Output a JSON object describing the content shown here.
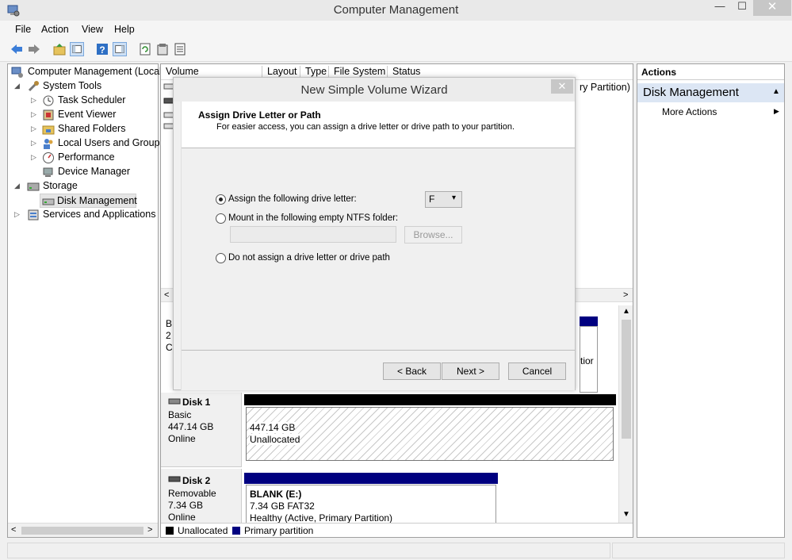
{
  "window": {
    "title": "Computer Management",
    "min_label": "—",
    "max_label": "☐",
    "close_label": "✕"
  },
  "menu": [
    "File",
    "Action",
    "View",
    "Help"
  ],
  "tree": {
    "root": "Computer Management (Local",
    "system_tools": "System Tools",
    "task_scheduler": "Task Scheduler",
    "event_viewer": "Event Viewer",
    "shared_folders": "Shared Folders",
    "local_users": "Local Users and Groups",
    "performance": "Performance",
    "device_manager": "Device Manager",
    "storage": "Storage",
    "disk_management": "Disk Management",
    "services": "Services and Applications"
  },
  "volume_list": {
    "columns": [
      "Volume",
      "Layout",
      "Type",
      "File System",
      "Status"
    ],
    "status_fragment": "ry Partition)",
    "scroll_left": "<",
    "scroll_right": ">"
  },
  "disk_view": {
    "partial_left_lines": [
      "B",
      "2",
      "C"
    ],
    "partial_right_text": "tior",
    "disk1": {
      "name": "Disk 1",
      "type": "Basic",
      "size": "447.14 GB",
      "state": "Online",
      "partition_size": "447.14 GB",
      "partition_label": "Unallocated"
    },
    "disk2": {
      "name": "Disk 2",
      "type": "Removable",
      "size": "7.34 GB",
      "state": "Online",
      "partition_name": "BLANK  (E:)",
      "partition_size": "7.34 GB FAT32",
      "partition_status": "Healthy (Active, Primary Partition)"
    },
    "legend": [
      {
        "label": "Unallocated",
        "color": "#000000"
      },
      {
        "label": "Primary partition",
        "color": "#000080"
      }
    ]
  },
  "actions": {
    "header": "Actions",
    "section": "Disk Management",
    "more": "More Actions"
  },
  "wizard": {
    "title": "New Simple Volume Wizard",
    "close_label": "✕",
    "heading": "Assign Drive Letter or Path",
    "subheading": "For easier access, you can assign a drive letter or drive path to your partition.",
    "option_letter": "Assign the following drive letter:",
    "option_folder": "Mount in the following empty NTFS folder:",
    "option_none": "Do not assign a drive letter or drive path",
    "drive_letter": "F",
    "folder_path": "",
    "browse": "Browse...",
    "back": "< Back",
    "next": "Next >",
    "cancel": "Cancel"
  },
  "colors": {
    "primary_partition": "#000080",
    "unallocated": "#000000",
    "actions_section_bg": "#dce6f4"
  }
}
